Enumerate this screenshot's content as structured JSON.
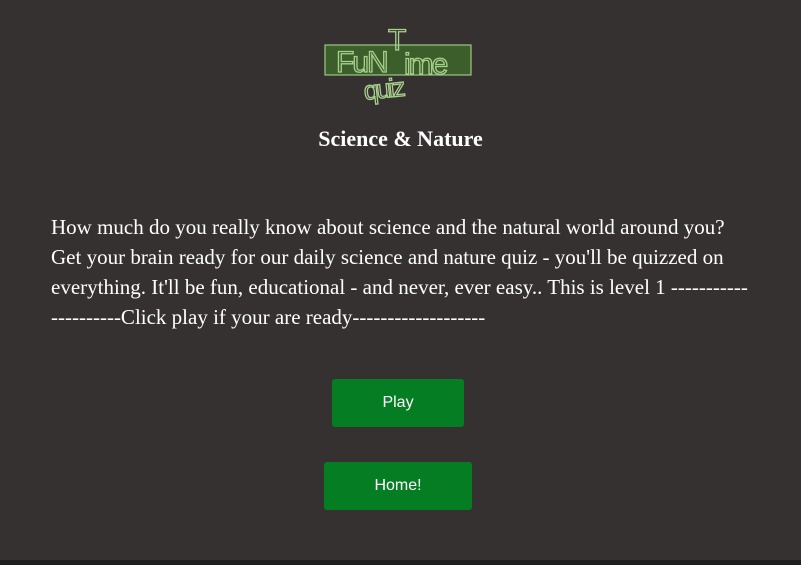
{
  "logo": {
    "name": "FunTime quiz logo",
    "text": "FuNTime quiz",
    "colors": {
      "fill": "#3a5f2a",
      "stroke": "#8fbf74"
    }
  },
  "page": {
    "title": "Science & Nature",
    "description": "How much do you really know about science and the natural world around you? Get your brain ready for our daily science and nature quiz - you'll be quizzed on everything. It'll be fun, educational - and never, ever easy.. This is level 1 ---------------------Click play if your are ready-------------------"
  },
  "buttons": {
    "play_label": "Play",
    "home_label": "Home!"
  },
  "colors": {
    "background": "#353131",
    "button": "#057d22",
    "text": "#ffffff"
  }
}
